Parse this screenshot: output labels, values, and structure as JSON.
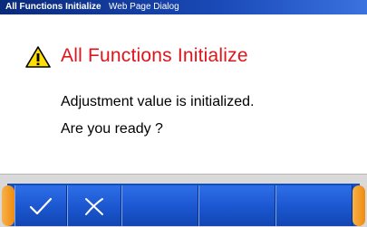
{
  "titlebar": {
    "app_title": "All Functions Initialize",
    "window_label": "Web Page Dialog"
  },
  "dialog": {
    "heading": "All Functions Initialize",
    "message_line1": "Adjustment value is initialized.",
    "message_line2": "Are you ready ?",
    "icon": "warning-icon"
  },
  "function_keys": [
    {
      "icon": "checkmark-icon",
      "action": "ok"
    },
    {
      "icon": "cancel-x-icon",
      "action": "cancel"
    },
    {
      "icon": "",
      "action": ""
    },
    {
      "icon": "",
      "action": ""
    },
    {
      "icon": "",
      "action": ""
    }
  ],
  "colors": {
    "heading": "#e0141b",
    "titlebar": "#1a4ab8",
    "fkey": "#1b56cf",
    "cap": "#f08a10"
  }
}
